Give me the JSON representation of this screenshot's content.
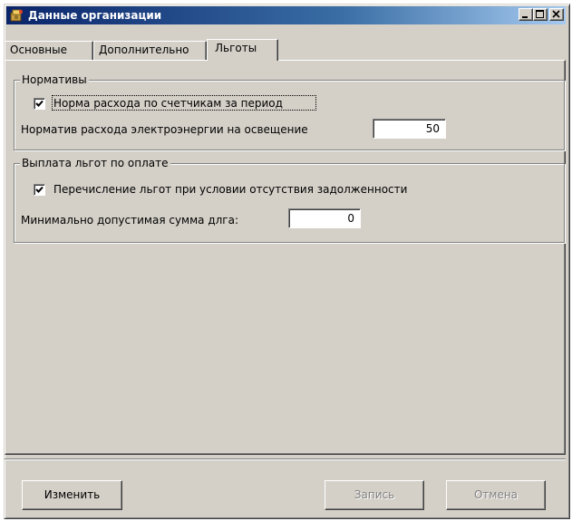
{
  "window": {
    "title": "Данные организации",
    "icon": "app-icon",
    "controls": [
      "minimize-icon",
      "maximize-icon",
      "close-icon"
    ]
  },
  "tabs": [
    {
      "label": "Основные",
      "active": false
    },
    {
      "label": "Дополнительно",
      "active": false
    },
    {
      "label": "Льготы",
      "active": true
    }
  ],
  "group_norms": {
    "title": "Нормативы",
    "checkbox_label": "Норма расхода по счетчикам за период",
    "checkbox_checked": true,
    "field_label": "Норматив расхода электроэнергии на освещение",
    "field_value": "50"
  },
  "group_benefits": {
    "title": "Выплата льгот по оплате",
    "checkbox_label": "Перечисление льгот при условии отсутствия задолженности",
    "checkbox_checked": true,
    "field_label": "Минимально допустимая сумма длга:",
    "field_value": "0"
  },
  "buttons": {
    "edit": "Изменить",
    "save": "Запись",
    "cancel": "Отмена"
  },
  "colors": {
    "face": "#d4d0c8",
    "title_start": "#0a246a",
    "title_end": "#a6caf0",
    "disabled_text": "#808080"
  }
}
